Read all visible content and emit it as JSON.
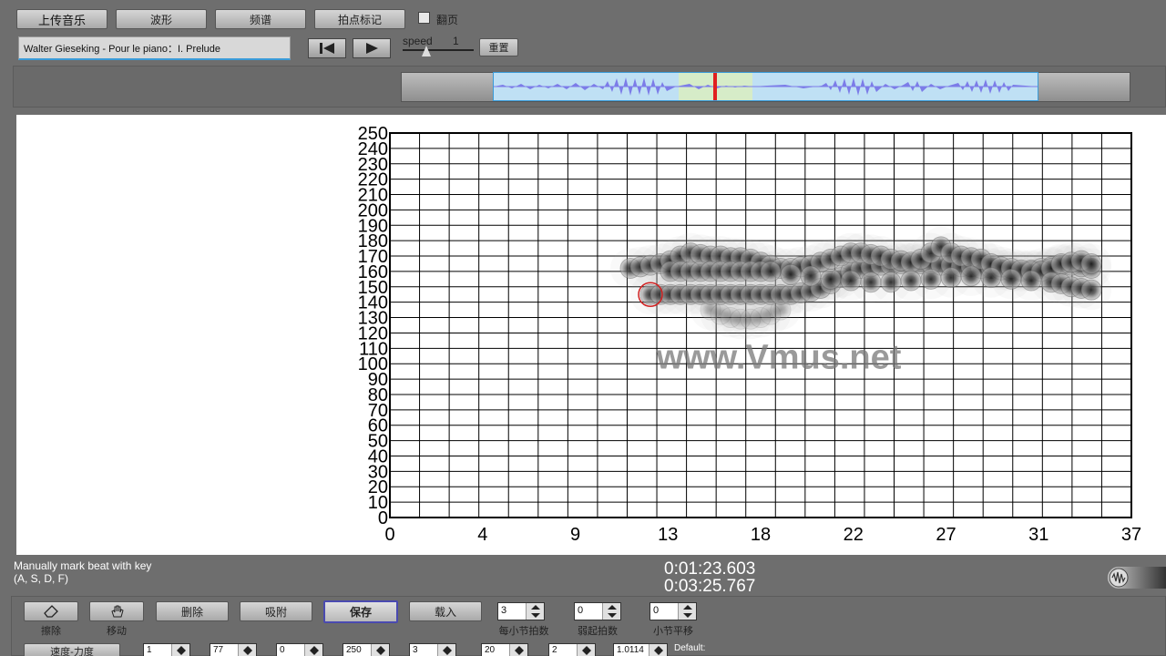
{
  "toolbar": {
    "upload": "上传音乐",
    "waveform": "波形",
    "spectrum": "频谱",
    "beat_mark": "拍点标记",
    "page_turn": "翻页"
  },
  "player": {
    "song_title": "Walter Gieseking - Pour le piano：I. Prelude",
    "speed_label": "speed",
    "speed_value": "1",
    "reset": "重置"
  },
  "chart_data": {
    "type": "scatter",
    "x_ticks": [
      "0",
      "4",
      "9",
      "13",
      "18",
      "22",
      "27",
      "31",
      "37"
    ],
    "y_ticks": [
      "0",
      "10",
      "20",
      "30",
      "40",
      "50",
      "60",
      "70",
      "80",
      "90",
      "100",
      "110",
      "120",
      "130",
      "140",
      "150",
      "160",
      "170",
      "180",
      "190",
      "200",
      "210",
      "220",
      "230",
      "240",
      "250"
    ],
    "xlim": [
      0,
      37
    ],
    "ylim": [
      0,
      250
    ],
    "watermark": "www.Vmus.net",
    "series": [
      {
        "x": [
          13.0,
          13.5,
          14.0,
          14.5,
          15.0,
          15.5,
          16.0,
          16.5,
          17.0,
          17.5,
          18.0,
          18.5,
          19.0,
          19.5,
          20.0,
          20.5,
          21.0,
          21.5,
          22.0,
          22.5,
          23.0,
          23.5,
          24.0,
          24.5,
          25.0,
          25.5,
          26.0,
          26.5,
          27.0,
          27.5,
          28.0,
          28.5,
          29.0,
          29.5,
          30.0,
          30.5,
          31.0,
          31.5,
          32.0,
          32.5,
          33.0,
          33.5,
          34.0,
          34.5,
          35.0
        ],
        "y": [
          145,
          145,
          145,
          145,
          145,
          145,
          145,
          145,
          145,
          145,
          145,
          145,
          145,
          145,
          145,
          146,
          147,
          149,
          152,
          156,
          160,
          162,
          163,
          164,
          164,
          165,
          165,
          165,
          165,
          164,
          164,
          163,
          163,
          162,
          162,
          161,
          160,
          160,
          161,
          162,
          163,
          164,
          164,
          163,
          162
        ]
      },
      {
        "x": [
          12.0,
          12.5,
          13.0,
          13.5,
          14.0,
          14.5,
          15.0,
          15.5,
          16.0,
          16.5,
          17.0,
          17.5,
          18.0,
          18.5,
          19.0,
          19.5,
          20.0,
          20.5,
          21.0,
          21.5,
          22.0,
          22.5,
          23.0,
          23.5,
          24.0,
          24.5,
          25.0,
          25.5,
          26.0,
          26.5,
          27.0,
          27.5,
          28.0,
          28.5,
          29.0,
          29.5,
          30.0,
          30.5,
          31.0,
          31.5,
          32.0,
          32.5,
          33.0,
          33.5,
          34.0,
          34.5,
          35.0
        ],
        "y": [
          162,
          163,
          164,
          165,
          167,
          170,
          172,
          171,
          170,
          170,
          169,
          169,
          168,
          166,
          164,
          162,
          162,
          163,
          164,
          166,
          168,
          170,
          172,
          172,
          171,
          170,
          168,
          167,
          166,
          168,
          172,
          176,
          172,
          170,
          169,
          168,
          165,
          163,
          162,
          161,
          160,
          160,
          162,
          165,
          166,
          167,
          165
        ]
      },
      {
        "x": [
          14.0,
          14.5,
          15.0,
          15.5,
          16.0,
          16.5,
          17.0,
          17.5,
          18.0,
          18.5,
          19.0,
          20.0,
          21.0,
          22.0,
          23.0,
          24.0,
          25.0,
          26.0,
          27.0,
          28.0,
          29.0,
          30.0,
          31.0,
          32.0,
          33.0,
          33.5,
          34.0,
          34.5,
          35.0
        ],
        "y": [
          160,
          160,
          160,
          160,
          160,
          160,
          160,
          160,
          160,
          160,
          160,
          158,
          157,
          155,
          154,
          153,
          153,
          154,
          155,
          156,
          157,
          156,
          155,
          154,
          153,
          152,
          150,
          149,
          148
        ]
      },
      {
        "x": [
          16.0,
          16.5,
          17.0,
          17.5,
          18.0,
          18.5,
          19.0,
          19.5
        ],
        "y": [
          135,
          132,
          130,
          129,
          129,
          130,
          132,
          135
        ]
      }
    ],
    "highlight_point": {
      "x": 13.0,
      "y": 145
    }
  },
  "status": {
    "instruction_line1": "Manually mark beat with key",
    "instruction_line2": "(A, S, D, F)",
    "current_time": "0:01:23.603",
    "total_time": "0:03:25.767"
  },
  "bottom_toolbar": {
    "erase": "擦除",
    "move": "移动",
    "delete": "删除",
    "snap": "吸附",
    "save": "保存",
    "load": "载入",
    "beats_per_bar_value": "3",
    "beats_per_bar_label": "每小节拍数",
    "pickup_value": "0",
    "pickup_label": "弱起拍数",
    "bar_shift_value": "0",
    "bar_shift_label": "小节平移"
  },
  "bottom_row2": {
    "button": "速度-力度",
    "fields": [
      "1",
      "77",
      "0",
      "250",
      "3",
      "20",
      "2",
      "1.0114"
    ],
    "default_label": "Default:"
  }
}
